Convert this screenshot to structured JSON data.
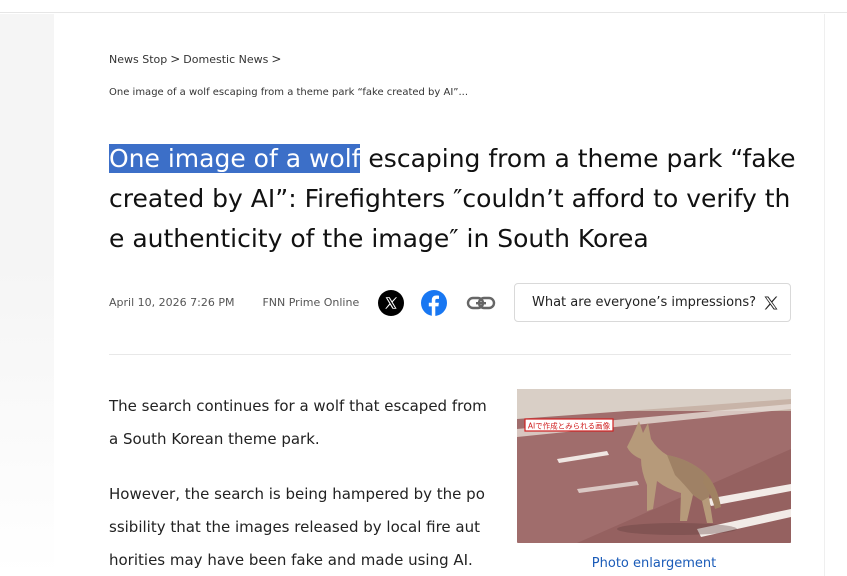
{
  "breadcrumb": {
    "items": [
      "News Stop",
      "Domestic News"
    ],
    "separator": ">"
  },
  "sub_crumb": "One image of a wolf escaping from a theme park “fake created by AI”...",
  "headline": {
    "selected_part": "One image of a wolf",
    "rest": " escaping from a theme park “fake created by AI”: Firefighters ″couldn’t afford to verify the authenticity of the image″ in South Korea"
  },
  "meta": {
    "date": "April 10, 2026 7:26 PM",
    "source": "FNN Prime Online"
  },
  "share": {
    "x_icon": "x-logo-icon",
    "facebook_icon": "facebook-icon",
    "link_icon": "link-icon"
  },
  "impressions": {
    "label": "What are everyone’s impressions?",
    "icon": "x-logo-icon"
  },
  "article": {
    "paragraphs": [
      "The search continues for a wolf that escaped from a South Korean theme park.",
      "However, the search is being hampered by the possibility that the images released by local fire authorities may have been fake and made using AI."
    ]
  },
  "photo": {
    "overlay_text": "AIで作成とみられる画像",
    "caption": "Photo enlargement"
  },
  "colors": {
    "selection": "#3c6fc8",
    "facebook": "#1877f2",
    "caption_link": "#1a5bb8"
  }
}
